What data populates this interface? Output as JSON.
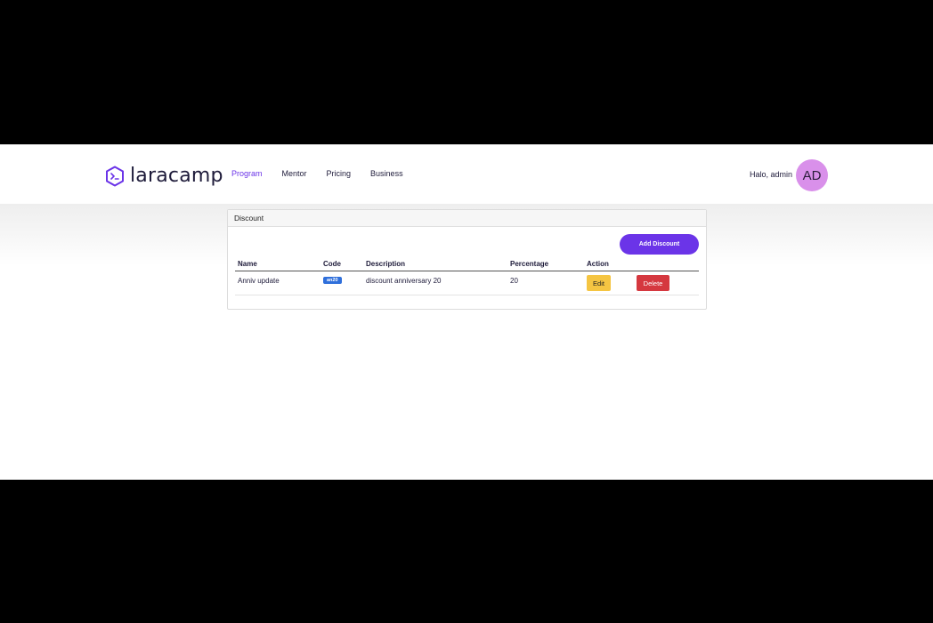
{
  "brand": {
    "name": "laracamp",
    "accent": "#6b34e8"
  },
  "nav": {
    "items": [
      {
        "label": "Program",
        "active": true
      },
      {
        "label": "Mentor",
        "active": false
      },
      {
        "label": "Pricing",
        "active": false
      },
      {
        "label": "Business",
        "active": false
      }
    ]
  },
  "user": {
    "greeting": "Halo, admin",
    "initials": "AD"
  },
  "card": {
    "title": "Discount",
    "add_button": "Add Discount",
    "columns": [
      "Name",
      "Code",
      "Description",
      "Percentage",
      "Action"
    ],
    "rows": [
      {
        "name": "Anniv update",
        "code": "an20",
        "description": "discount anniversary 20",
        "percentage": "20",
        "edit_label": "Edit",
        "delete_label": "Delete"
      }
    ]
  }
}
